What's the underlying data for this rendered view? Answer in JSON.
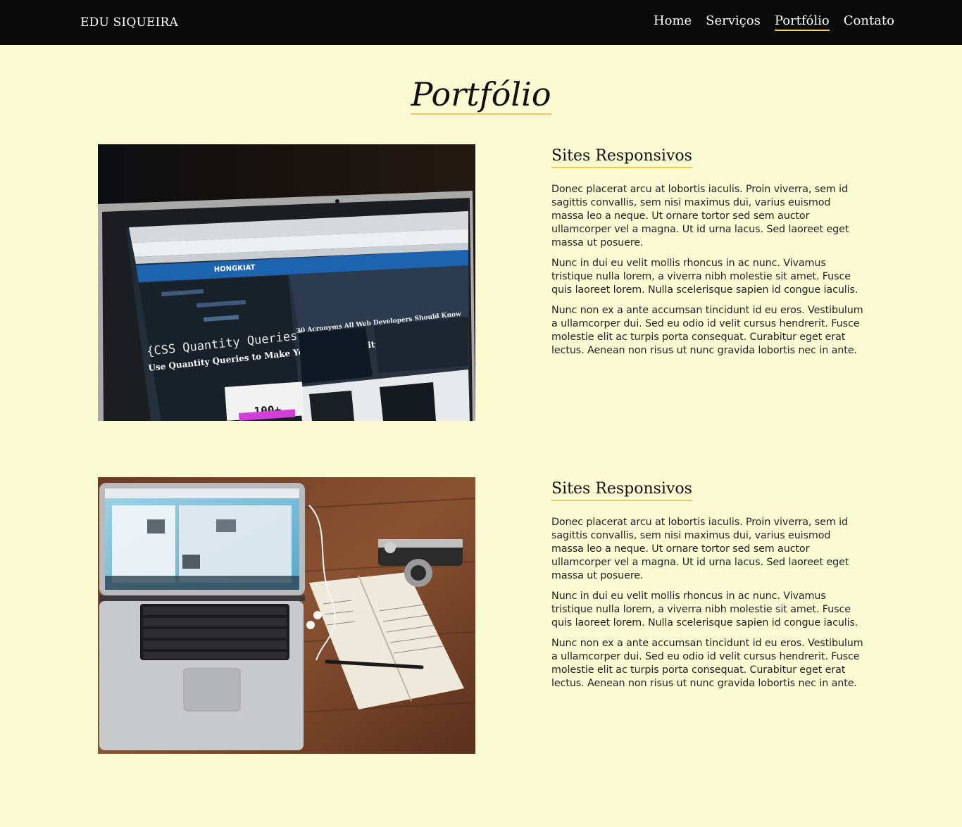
{
  "header": {
    "brand": "EDU SIQUEIRA",
    "nav": [
      {
        "label": "Home"
      },
      {
        "label": "Serviços"
      },
      {
        "label": "Portfólio"
      },
      {
        "label": "Contato"
      }
    ],
    "active_index": 2
  },
  "page": {
    "title": "Portfólio"
  },
  "portfolio": [
    {
      "title": "Sites Responsivos",
      "image_icon": "laptop-browser-photo",
      "paragraphs": [
        "Donec placerat arcu at lobortis iaculis. Proin viverra, sem id sagittis convallis, sem nisi maximus dui, varius euismod massa leo a neque. Ut ornare tortor sed sem auctor ullamcorper vel a magna. Ut id urna lacus. Sed laoreet eget massa ut posuere.",
        "Nunc in dui eu velit mollis rhoncus in ac nunc. Vivamus tristique nulla lorem, a viverra nibh molestie sit amet. Fusce quis laoreet lorem. Nulla scelerisque sapien id congue iaculis.",
        "Nunc non ex a ante accumsan tincidunt id eu eros. Vestibulum a ullamcorper dui. Sed eu odio id velit cursus hendrerit. Fusce molestie elit ac turpis porta consequat. Curabitur eget erat lectus. Aenean non risus ut nunc gravida lobortis nec in ante."
      ]
    },
    {
      "title": "Sites Responsivos",
      "image_icon": "laptop-desk-photo",
      "paragraphs": [
        "Donec placerat arcu at lobortis iaculis. Proin viverra, sem id sagittis convallis, sem nisi maximus dui, varius euismod massa leo a neque. Ut ornare tortor sed sem auctor ullamcorper vel a magna. Ut id urna lacus. Sed laoreet eget massa ut posuere.",
        "Nunc in dui eu velit mollis rhoncus in ac nunc. Vivamus tristique nulla lorem, a viverra nibh molestie sit amet. Fusce quis laoreet lorem. Nulla scelerisque sapien id congue iaculis.",
        "Nunc non ex a ante accumsan tincidunt id eu eros. Vestibulum a ullamcorper dui. Sed eu odio id velit cursus hendrerit. Fusce molestie elit ac turpis porta consequat. Curabitur eget erat lectus. Aenean non risus ut nunc gravida lobortis nec in ante."
      ]
    }
  ],
  "photo1_text": {
    "browser_brand": "HONGKIAT",
    "article_title": "{CSS Quantity Queries}",
    "article_subtitle": "Use Quantity Queries to Make Your CSS Quantity-Aware",
    "side_headline": "30 Acronyms All Web Developers Should Know",
    "promo": "100+"
  },
  "colors": {
    "background": "#fbfbd3",
    "navbar": "#0a0a0a",
    "accent": "#f2c94c"
  }
}
